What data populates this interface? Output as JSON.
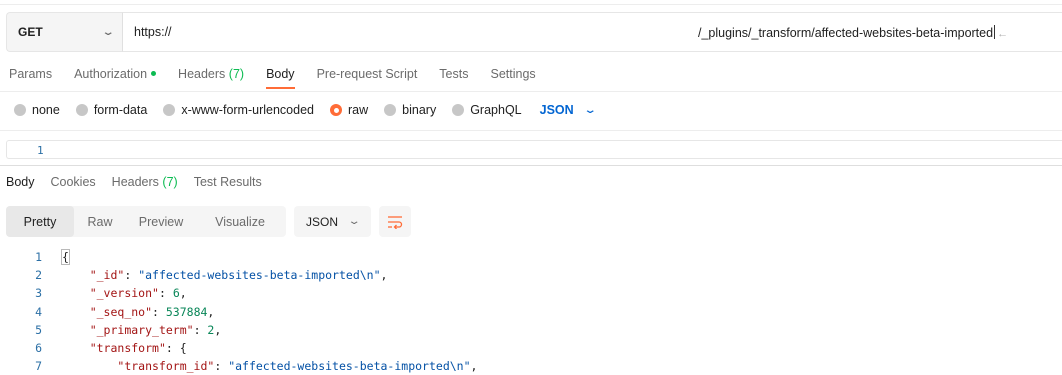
{
  "request": {
    "method": "GET",
    "url_start": "https://",
    "url_end": "/_plugins/_transform/affected-websites-beta-imported",
    "url_suffix_glyph": "←"
  },
  "request_tabs": [
    {
      "label": "Params",
      "active": false
    },
    {
      "label": "Authorization",
      "active": false,
      "dot": true
    },
    {
      "label": "Headers",
      "count": "(7)",
      "active": false
    },
    {
      "label": "Body",
      "active": true
    },
    {
      "label": "Pre-request Script",
      "active": false
    },
    {
      "label": "Tests",
      "active": false
    },
    {
      "label": "Settings",
      "active": false
    }
  ],
  "body_types": [
    {
      "label": "none",
      "selected": false
    },
    {
      "label": "form-data",
      "selected": false
    },
    {
      "label": "x-www-form-urlencoded",
      "selected": false
    },
    {
      "label": "raw",
      "selected": true
    },
    {
      "label": "binary",
      "selected": false
    },
    {
      "label": "GraphQL",
      "selected": false
    }
  ],
  "body_language": "JSON",
  "request_editor": {
    "line_number": "1"
  },
  "response_tabs": [
    {
      "label": "Body",
      "active": true
    },
    {
      "label": "Cookies",
      "active": false
    },
    {
      "label": "Headers",
      "count": "(7)",
      "active": false
    },
    {
      "label": "Test Results",
      "active": false
    }
  ],
  "view_modes": [
    {
      "label": "Pretty",
      "active": true
    },
    {
      "label": "Raw",
      "active": false
    },
    {
      "label": "Preview",
      "active": false
    },
    {
      "label": "Visualize",
      "active": false
    }
  ],
  "response_format": "JSON",
  "colors": {
    "accent": "#ff6c37",
    "success": "#0cbb52",
    "link": "#0265d2",
    "json_key": "#a31515",
    "json_string": "#0451a5",
    "json_number": "#098658",
    "line_number": "#2b6fa5"
  },
  "response_lines": [
    {
      "num": "1",
      "indent": 0,
      "tokens": [
        {
          "t": "{",
          "c": "p"
        }
      ]
    },
    {
      "num": "2",
      "indent": 1,
      "tokens": [
        {
          "t": "\"_id\"",
          "c": "k"
        },
        {
          "t": ": ",
          "c": "p"
        },
        {
          "t": "\"affected-websites-beta-imported\\n\"",
          "c": "s"
        },
        {
          "t": ",",
          "c": "p"
        }
      ]
    },
    {
      "num": "3",
      "indent": 1,
      "tokens": [
        {
          "t": "\"_version\"",
          "c": "k"
        },
        {
          "t": ": ",
          "c": "p"
        },
        {
          "t": "6",
          "c": "n"
        },
        {
          "t": ",",
          "c": "p"
        }
      ]
    },
    {
      "num": "4",
      "indent": 1,
      "tokens": [
        {
          "t": "\"_seq_no\"",
          "c": "k"
        },
        {
          "t": ": ",
          "c": "p"
        },
        {
          "t": "537884",
          "c": "n"
        },
        {
          "t": ",",
          "c": "p"
        }
      ]
    },
    {
      "num": "5",
      "indent": 1,
      "tokens": [
        {
          "t": "\"_primary_term\"",
          "c": "k"
        },
        {
          "t": ": ",
          "c": "p"
        },
        {
          "t": "2",
          "c": "n"
        },
        {
          "t": ",",
          "c": "p"
        }
      ]
    },
    {
      "num": "6",
      "indent": 1,
      "tokens": [
        {
          "t": "\"transform\"",
          "c": "k"
        },
        {
          "t": ": {",
          "c": "p"
        }
      ]
    },
    {
      "num": "7",
      "indent": 2,
      "tokens": [
        {
          "t": "\"transform_id\"",
          "c": "k"
        },
        {
          "t": ": ",
          "c": "p"
        },
        {
          "t": "\"affected-websites-beta-imported\\n\"",
          "c": "s"
        },
        {
          "t": ",",
          "c": "p"
        }
      ]
    }
  ]
}
